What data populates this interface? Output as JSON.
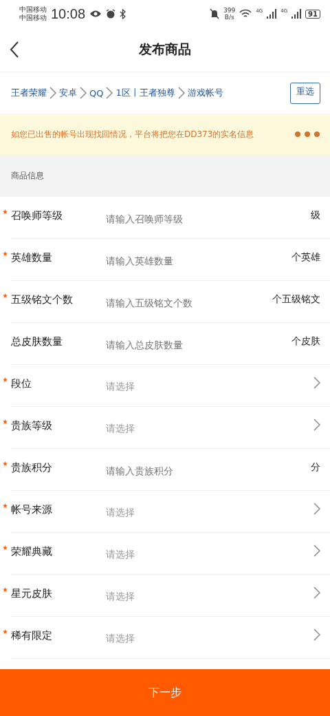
{
  "status_bar": {
    "carriers": [
      "中国移动",
      "中国移动"
    ],
    "time": "10:08",
    "speed": [
      "399",
      "B/s"
    ],
    "network": [
      "4G",
      "4G"
    ],
    "battery": "91"
  },
  "header": {
    "title": "发布商品"
  },
  "breadcrumb": {
    "items": [
      "王者荣耀",
      "安卓",
      "QQ",
      "1区丨王者独尊",
      "游戏帐号"
    ],
    "action": "重选"
  },
  "notice": {
    "text": "如您已出售的帐号出现找回情况，平台将把您在DD373的实名信息"
  },
  "section": {
    "title": "商品信息"
  },
  "fields": [
    {
      "kind": "input",
      "label": "召唤师等级",
      "required": true,
      "placeholder": "请输入召唤师等级",
      "unit": "级"
    },
    {
      "kind": "input",
      "label": "英雄数量",
      "required": true,
      "placeholder": "请输入英雄数量",
      "unit": "个英雄"
    },
    {
      "kind": "input",
      "label": "五级铭文个数",
      "required": true,
      "placeholder": "请输入五级铭文个数",
      "unit": "个五级铭文"
    },
    {
      "kind": "input",
      "label": "总皮肤数量",
      "required": false,
      "placeholder": "请输入总皮肤数量",
      "unit": "个皮肤"
    },
    {
      "kind": "select",
      "label": "段位",
      "required": true,
      "placeholder": "请选择"
    },
    {
      "kind": "select",
      "label": "贵族等级",
      "required": true,
      "placeholder": "请选择"
    },
    {
      "kind": "input",
      "label": "贵族积分",
      "required": true,
      "placeholder": "请输入贵族积分",
      "unit": "分"
    },
    {
      "kind": "select",
      "label": "帐号来源",
      "required": true,
      "placeholder": "请选择"
    },
    {
      "kind": "select",
      "label": "荣耀典藏",
      "required": true,
      "placeholder": "请选择"
    },
    {
      "kind": "select",
      "label": "星元皮肤",
      "required": true,
      "placeholder": "请选择"
    },
    {
      "kind": "select",
      "label": "稀有限定",
      "required": true,
      "placeholder": "请选择"
    }
  ],
  "footer": {
    "button": "下一步"
  }
}
